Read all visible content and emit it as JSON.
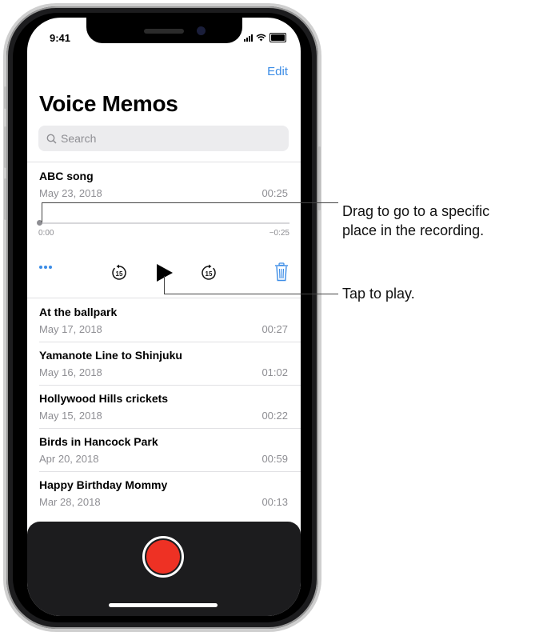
{
  "status_bar": {
    "time": "9:41"
  },
  "header": {
    "edit_label": "Edit",
    "title": "Voice Memos"
  },
  "search": {
    "placeholder": "Search"
  },
  "expanded_memo": {
    "title": "ABC song",
    "date": "May 23, 2018",
    "duration": "00:25",
    "elapsed": "0:00",
    "remaining": "−0:25",
    "playback_progress": 0
  },
  "controls": {
    "more_icon": "ellipsis-icon",
    "skip_back_icon": "skip-back-15-icon",
    "skip_back_label": "15",
    "play_icon": "play-icon",
    "skip_forward_icon": "skip-forward-15-icon",
    "skip_forward_label": "15",
    "trash_icon": "trash-icon"
  },
  "memos": [
    {
      "title": "At the ballpark",
      "date": "May 17, 2018",
      "duration": "00:27"
    },
    {
      "title": "Yamanote Line to Shinjuku",
      "date": "May 16, 2018",
      "duration": "01:02"
    },
    {
      "title": "Hollywood Hills crickets",
      "date": "May 15, 2018",
      "duration": "00:22"
    },
    {
      "title": "Birds in Hancock Park",
      "date": "Apr 20, 2018",
      "duration": "00:59"
    },
    {
      "title": "Happy Birthday Mommy",
      "date": "Mar 28, 2018",
      "duration": "00:13"
    }
  ],
  "record_button": {
    "icon": "record-icon",
    "color": "#ee3124"
  },
  "callouts": {
    "scrub_line1": "Drag to go to a specific",
    "scrub_line2": "place in the recording.",
    "play": "Tap to play."
  },
  "colors": {
    "accent": "#3b8ce6",
    "secondary_text": "#8e8e93",
    "record": "#ee3124"
  }
}
